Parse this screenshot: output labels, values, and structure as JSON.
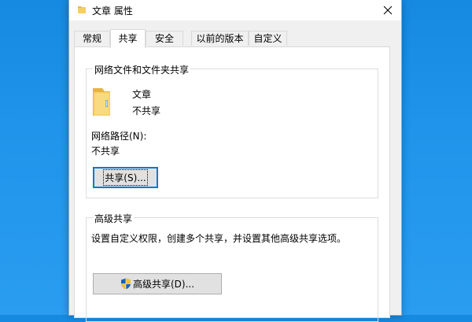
{
  "window": {
    "title": "文章 属性"
  },
  "tabs": [
    {
      "label": "常规"
    },
    {
      "label": "共享"
    },
    {
      "label": "安全"
    },
    {
      "label": "以前的版本"
    },
    {
      "label": "自定义"
    }
  ],
  "active_tab": "共享",
  "network_sharing": {
    "group_title": "网络文件和文件夹共享",
    "folder_name": "文章",
    "folder_status": "不共享",
    "path_label": "网络路径(N):",
    "path_value": "不共享",
    "share_button": "共享(S)..."
  },
  "advanced_sharing": {
    "group_title": "高级共享",
    "description": "设置自定义权限，创建多个共享，并设置其他高级共享选项。",
    "button": "高级共享(D)..."
  },
  "icons": {
    "title_icon": "folder-icon",
    "close": "close-icon",
    "folder": "folder-icon",
    "shield": "uac-shield-icon"
  },
  "colors": {
    "desktop": "#1f94ea",
    "dialog_bg": "#f0f0f0",
    "panel_bg": "#ffffff",
    "focus_border": "#0078d7"
  }
}
